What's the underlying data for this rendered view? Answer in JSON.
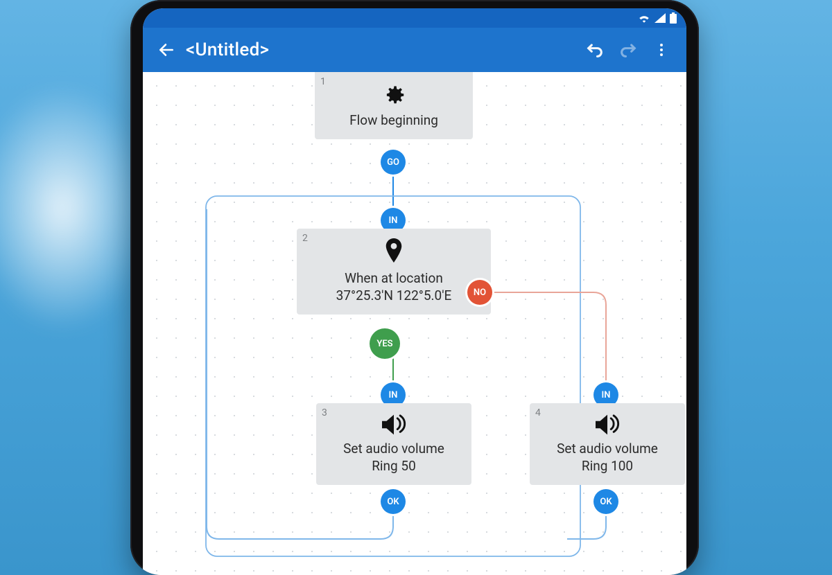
{
  "statusbar": {
    "wifi": "wifi-icon",
    "signal": "cell-signal-icon",
    "battery": "battery-icon"
  },
  "appbar": {
    "title": "<Untitled>",
    "back_label": "Back",
    "undo_label": "Undo",
    "redo_label": "Redo",
    "overflow_label": "More"
  },
  "ports": {
    "go": "GO",
    "in": "IN",
    "yes": "YES",
    "no": "NO",
    "ok": "OK"
  },
  "nodes": {
    "n1": {
      "num": "1",
      "title": "Flow beginning"
    },
    "n2": {
      "num": "2",
      "title": "When at location",
      "subtitle": "37°25.3'N 122°5.0'E"
    },
    "n3": {
      "num": "3",
      "title": "Set audio volume",
      "subtitle": "Ring 50"
    },
    "n4": {
      "num": "4",
      "title": "Set audio volume",
      "subtitle": "Ring 100"
    }
  },
  "colors": {
    "appbar": "#1e74cd",
    "port_blue": "#1e88e5",
    "port_green": "#3f9e4d",
    "port_red": "#e25336"
  }
}
